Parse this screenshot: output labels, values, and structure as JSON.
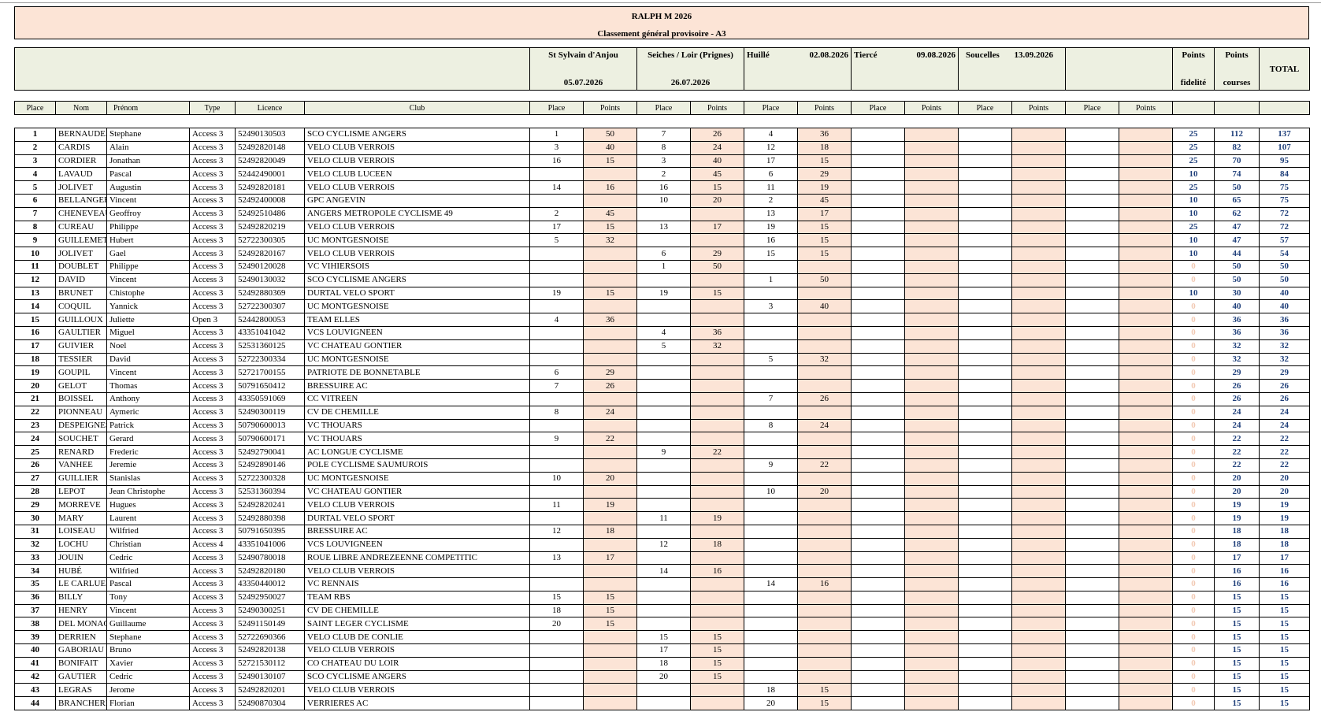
{
  "title": "RALPH M 2026",
  "subtitle": "Classement général provisoire - A3",
  "races": [
    {
      "name": "St Sylvain d'Anjou",
      "date": "05.07.2026"
    },
    {
      "name": "Seiches / Loir (Prignes)",
      "date": "26.07.2026"
    },
    {
      "name": "Huillé",
      "date": "02.08.2026"
    },
    {
      "name": "Tiercé",
      "date": "09.08.2026"
    },
    {
      "name": "Soucelles",
      "date": "13.09.2026"
    }
  ],
  "summary_headers": {
    "fidelity_top": "Points",
    "fidelity_bottom": "fidelité",
    "courses_top": "Points",
    "courses_bottom": "courses",
    "total": "TOTAL"
  },
  "columns": [
    "Place",
    "Nom",
    "Prénom",
    "Type",
    "Licence",
    "Club",
    "Place",
    "Points",
    "Place",
    "Points",
    "Place",
    "Points",
    "Place",
    "Points",
    "Place",
    "Points",
    "Place",
    "Points"
  ],
  "rows": [
    [
      "1",
      "BERNAUDEAU",
      "Stephane",
      "Access  3",
      "52490130503",
      "SCO CYCLISME ANGERS",
      "1",
      "50",
      "7",
      "26",
      "4",
      "36",
      "",
      "",
      "",
      "",
      "",
      "",
      "25",
      "112",
      "137"
    ],
    [
      "2",
      "CARDIS",
      "Alain",
      "Access  3",
      "52492820148",
      "VELO CLUB VERROIS",
      "3",
      "40",
      "8",
      "24",
      "12",
      "18",
      "",
      "",
      "",
      "",
      "",
      "",
      "25",
      "82",
      "107"
    ],
    [
      "3",
      "CORDIER",
      "Jonathan",
      "Access  3",
      "52492820049",
      "VELO CLUB VERROIS",
      "16",
      "15",
      "3",
      "40",
      "17",
      "15",
      "",
      "",
      "",
      "",
      "",
      "",
      "25",
      "70",
      "95"
    ],
    [
      "4",
      "LAVAUD",
      "Pascal",
      "Access  3",
      "52442490001",
      "VELO CLUB LUCEEN",
      "",
      "",
      "2",
      "45",
      "6",
      "29",
      "",
      "",
      "",
      "",
      "",
      "",
      "10",
      "74",
      "84"
    ],
    [
      "5",
      "JOLIVET",
      "Augustin",
      "Access  3",
      "52492820181",
      "VELO CLUB VERROIS",
      "14",
      "16",
      "16",
      "15",
      "11",
      "19",
      "",
      "",
      "",
      "",
      "",
      "",
      "25",
      "50",
      "75"
    ],
    [
      "6",
      "BELLANGER",
      "Vincent",
      "Access  3",
      "52492400008",
      "GPC ANGEVIN",
      "",
      "",
      "10",
      "20",
      "2",
      "45",
      "",
      "",
      "",
      "",
      "",
      "",
      "10",
      "65",
      "75"
    ],
    [
      "7",
      "CHENEVEAU",
      "Geoffroy",
      "Access  3",
      "52492510486",
      "ANGERS METROPOLE CYCLISME 49",
      "2",
      "45",
      "",
      "",
      "13",
      "17",
      "",
      "",
      "",
      "",
      "",
      "",
      "10",
      "62",
      "72"
    ],
    [
      "8",
      "CUREAU",
      "Philippe",
      "Access  3",
      "52492820219",
      "VELO CLUB VERROIS",
      "17",
      "15",
      "13",
      "17",
      "19",
      "15",
      "",
      "",
      "",
      "",
      "",
      "",
      "25",
      "47",
      "72"
    ],
    [
      "9",
      "GUILLEMET",
      "Hubert",
      "Access  3",
      "52722300305",
      "UC MONTGESNOISE",
      "5",
      "32",
      "",
      "",
      "16",
      "15",
      "",
      "",
      "",
      "",
      "",
      "",
      "10",
      "47",
      "57"
    ],
    [
      "10",
      "JOLIVET",
      "Gael",
      "Access  3",
      "52492820167",
      "VELO CLUB VERROIS",
      "",
      "",
      "6",
      "29",
      "15",
      "15",
      "",
      "",
      "",
      "",
      "",
      "",
      "10",
      "44",
      "54"
    ],
    [
      "11",
      "DOUBLET",
      "Philippe",
      "Access  3",
      "52490120028",
      "VC VIHIERSOIS",
      "",
      "",
      "1",
      "50",
      "",
      "",
      "",
      "",
      "",
      "",
      "",
      "",
      "0",
      "50",
      "50"
    ],
    [
      "12",
      "DAVID",
      "Vincent",
      "Access  3",
      "52490130032",
      "SCO CYCLISME ANGERS",
      "",
      "",
      "",
      "",
      "1",
      "50",
      "",
      "",
      "",
      "",
      "",
      "",
      "0",
      "50",
      "50"
    ],
    [
      "13",
      "BRUNET",
      "Chistophe",
      "Access  3",
      "52492880369",
      "DURTAL VELO SPORT",
      "19",
      "15",
      "19",
      "15",
      "",
      "",
      "",
      "",
      "",
      "",
      "",
      "",
      "10",
      "30",
      "40"
    ],
    [
      "14",
      "COQUIL",
      "Yannick",
      "Access  3",
      "52722300307",
      "UC MONTGESNOISE",
      "",
      "",
      "",
      "",
      "3",
      "40",
      "",
      "",
      "",
      "",
      "",
      "",
      "0",
      "40",
      "40"
    ],
    [
      "15",
      "GUILLOUX",
      "Juliette",
      "Open  3",
      "52442800053",
      "TEAM ELLES",
      "4",
      "36",
      "",
      "",
      "",
      "",
      "",
      "",
      "",
      "",
      "",
      "",
      "0",
      "36",
      "36"
    ],
    [
      "16",
      "GAULTIER",
      "Miguel",
      "Access 3",
      "43351041042",
      "VCS LOUVIGNEEN",
      "",
      "",
      "4",
      "36",
      "",
      "",
      "",
      "",
      "",
      "",
      "",
      "",
      "0",
      "36",
      "36"
    ],
    [
      "17",
      "GUIVIER",
      "Noel",
      "Access  3",
      "52531360125",
      "VC CHATEAU GONTIER",
      "",
      "",
      "5",
      "32",
      "",
      "",
      "",
      "",
      "",
      "",
      "",
      "",
      "0",
      "32",
      "32"
    ],
    [
      "18",
      "TESSIER",
      "David",
      "Access  3",
      "52722300334",
      "UC MONTGESNOISE",
      "",
      "",
      "",
      "",
      "5",
      "32",
      "",
      "",
      "",
      "",
      "",
      "",
      "0",
      "32",
      "32"
    ],
    [
      "19",
      "GOUPIL",
      "Vincent",
      "Access  3",
      "52721700155",
      "PATRIOTE DE BONNETABLE",
      "6",
      "29",
      "",
      "",
      "",
      "",
      "",
      "",
      "",
      "",
      "",
      "",
      "0",
      "29",
      "29"
    ],
    [
      "20",
      "GELOT",
      "Thomas",
      "Access  3",
      "50791650412",
      "BRESSUIRE AC",
      "7",
      "26",
      "",
      "",
      "",
      "",
      "",
      "",
      "",
      "",
      "",
      "",
      "0",
      "26",
      "26"
    ],
    [
      "21",
      "BOISSEL",
      "Anthony",
      "Access  3",
      "43350591069",
      "CC VITREEN",
      "",
      "",
      "",
      "",
      "7",
      "26",
      "",
      "",
      "",
      "",
      "",
      "",
      "0",
      "26",
      "26"
    ],
    [
      "22",
      "PIONNEAU",
      "Aymeric",
      "Access  3",
      "52490300119",
      "CV DE CHEMILLE",
      "8",
      "24",
      "",
      "",
      "",
      "",
      "",
      "",
      "",
      "",
      "",
      "",
      "0",
      "24",
      "24"
    ],
    [
      "23",
      "DESPEIGNES",
      "Patrick",
      "Access  3",
      "50790600013",
      "VC THOUARS",
      "",
      "",
      "",
      "",
      "8",
      "24",
      "",
      "",
      "",
      "",
      "",
      "",
      "0",
      "24",
      "24"
    ],
    [
      "24",
      "SOUCHET",
      "Gerard",
      "Access  3",
      "50790600171",
      "VC THOUARS",
      "9",
      "22",
      "",
      "",
      "",
      "",
      "",
      "",
      "",
      "",
      "",
      "",
      "0",
      "22",
      "22"
    ],
    [
      "25",
      "RENARD",
      "Frederic",
      "Access  3",
      "52492790041",
      "AC LONGUE CYCLISME",
      "",
      "",
      "9",
      "22",
      "",
      "",
      "",
      "",
      "",
      "",
      "",
      "",
      "0",
      "22",
      "22"
    ],
    [
      "26",
      "VANHEE",
      "Jeremie",
      "Access  3",
      "52492890146",
      "POLE CYCLISME SAUMUROIS",
      "",
      "",
      "",
      "",
      "9",
      "22",
      "",
      "",
      "",
      "",
      "",
      "",
      "0",
      "22",
      "22"
    ],
    [
      "27",
      "GUILLIER",
      "Stanislas",
      "Access  3",
      "52722300328",
      "UC MONTGESNOISE",
      "10",
      "20",
      "",
      "",
      "",
      "",
      "",
      "",
      "",
      "",
      "",
      "",
      "0",
      "20",
      "20"
    ],
    [
      "28",
      "LEPOT",
      "Jean Christophe",
      "Access  3",
      "52531360394",
      "VC CHATEAU GONTIER",
      "",
      "",
      "",
      "",
      "10",
      "20",
      "",
      "",
      "",
      "",
      "",
      "",
      "0",
      "20",
      "20"
    ],
    [
      "29",
      "MORREVE",
      "Hugues",
      "Access  3",
      "52492820241",
      "VELO CLUB VERROIS",
      "11",
      "19",
      "",
      "",
      "",
      "",
      "",
      "",
      "",
      "",
      "",
      "",
      "0",
      "19",
      "19"
    ],
    [
      "30",
      "MARY",
      "Laurent",
      "Access  3",
      "52492880398",
      "DURTAL VELO SPORT",
      "",
      "",
      "11",
      "19",
      "",
      "",
      "",
      "",
      "",
      "",
      "",
      "",
      "0",
      "19",
      "19"
    ],
    [
      "31",
      "LOISEAU",
      "Wilfried",
      "Access  3",
      "50791650395",
      "BRESSUIRE AC",
      "12",
      "18",
      "",
      "",
      "",
      "",
      "",
      "",
      "",
      "",
      "",
      "",
      "0",
      "18",
      "18"
    ],
    [
      "32",
      "LOCHU",
      "Christian",
      "Access  4",
      "43351041006",
      "VCS LOUVIGNEEN",
      "",
      "",
      "12",
      "18",
      "",
      "",
      "",
      "",
      "",
      "",
      "",
      "",
      "0",
      "18",
      "18"
    ],
    [
      "33",
      "JOUIN",
      "Cedric",
      "Access  3",
      "52490780018",
      "ROUE LIBRE ANDREZEENNE COMPETITIC",
      "13",
      "17",
      "",
      "",
      "",
      "",
      "",
      "",
      "",
      "",
      "",
      "",
      "0",
      "17",
      "17"
    ],
    [
      "34",
      "HUBÉ",
      "Wilfried",
      "Access  3",
      "52492820180",
      "VELO CLUB VERROIS",
      "",
      "",
      "14",
      "16",
      "",
      "",
      "",
      "",
      "",
      "",
      "",
      "",
      "0",
      "16",
      "16"
    ],
    [
      "35",
      "LE CARLUER",
      "Pascal",
      "Access  3",
      "43350440012",
      "VC RENNAIS",
      "",
      "",
      "",
      "",
      "14",
      "16",
      "",
      "",
      "",
      "",
      "",
      "",
      "0",
      "16",
      "16"
    ],
    [
      "36",
      "BILLY",
      "Tony",
      "Access  3",
      "52492950027",
      "TEAM RBS",
      "15",
      "15",
      "",
      "",
      "",
      "",
      "",
      "",
      "",
      "",
      "",
      "",
      "0",
      "15",
      "15"
    ],
    [
      "37",
      "HENRY",
      "Vincent",
      "Access  3",
      "52490300251",
      "CV DE CHEMILLE",
      "18",
      "15",
      "",
      "",
      "",
      "",
      "",
      "",
      "",
      "",
      "",
      "",
      "0",
      "15",
      "15"
    ],
    [
      "38",
      "DEL MONACO",
      "Guillaume",
      "Access  3",
      "52491150149",
      "SAINT LEGER CYCLISME",
      "20",
      "15",
      "",
      "",
      "",
      "",
      "",
      "",
      "",
      "",
      "",
      "",
      "0",
      "15",
      "15"
    ],
    [
      "39",
      "DERRIEN",
      "Stephane",
      "Access 3",
      "52722690366",
      "VELO CLUB DE CONLIE",
      "",
      "",
      "15",
      "15",
      "",
      "",
      "",
      "",
      "",
      "",
      "",
      "",
      "0",
      "15",
      "15"
    ],
    [
      "40",
      "GABORIAU",
      "Bruno",
      "Access  3",
      "52492820138",
      "VELO CLUB VERROIS",
      "",
      "",
      "17",
      "15",
      "",
      "",
      "",
      "",
      "",
      "",
      "",
      "",
      "0",
      "15",
      "15"
    ],
    [
      "41",
      "BONIFAIT",
      "Xavier",
      "Access  3",
      "52721530112",
      "CO CHATEAU DU LOIR",
      "",
      "",
      "18",
      "15",
      "",
      "",
      "",
      "",
      "",
      "",
      "",
      "",
      "0",
      "15",
      "15"
    ],
    [
      "42",
      "GAUTIER",
      "Cedric",
      "Access  3",
      "52490130107",
      "SCO CYCLISME ANGERS",
      "",
      "",
      "20",
      "15",
      "",
      "",
      "",
      "",
      "",
      "",
      "",
      "",
      "0",
      "15",
      "15"
    ],
    [
      "43",
      "LEGRAS",
      "Jerome",
      "Access  3",
      "52492820201",
      "VELO CLUB VERROIS",
      "",
      "",
      "",
      "",
      "18",
      "15",
      "",
      "",
      "",
      "",
      "",
      "",
      "0",
      "15",
      "15"
    ],
    [
      "44",
      "BRANCHEREAU",
      "Florian",
      "Access  3",
      "52490870304",
      "VERRIERES AC",
      "",
      "",
      "",
      "",
      "20",
      "15",
      "",
      "",
      "",
      "",
      "",
      "",
      "0",
      "15",
      "15"
    ]
  ]
}
